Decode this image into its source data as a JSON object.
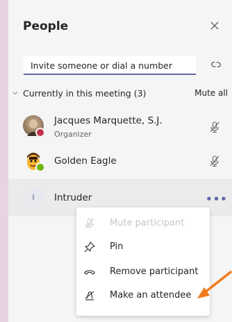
{
  "header": {
    "title": "People"
  },
  "invite": {
    "placeholder": "Invite someone or dial a number"
  },
  "section": {
    "label": "Currently in this meeting (3)",
    "mute_all": "Mute all"
  },
  "participants": [
    {
      "name": "Jacques Marquette, S.J.",
      "role": "Organizer",
      "status_color": "#c4314b"
    },
    {
      "name": "Golden Eagle",
      "role": "",
      "status_color": "#6bb700"
    },
    {
      "name": "Intruder",
      "initial": "I"
    }
  ],
  "menu": {
    "items": [
      {
        "label": "Mute participant",
        "disabled": true
      },
      {
        "label": "Pin"
      },
      {
        "label": "Remove participant"
      },
      {
        "label": "Make an attendee"
      }
    ]
  },
  "colors": {
    "accent": "#6264a7",
    "annotation_arrow": "#f07a1c"
  }
}
